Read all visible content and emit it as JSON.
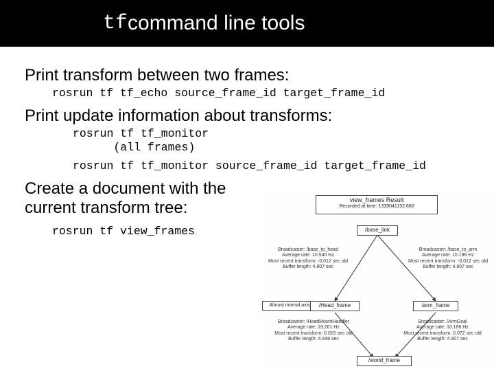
{
  "title": {
    "mono": "tf",
    "rest": " command line tools"
  },
  "sections": {
    "s1": {
      "head": "Print transform between two frames:",
      "cmd": "rosrun tf tf_echo source_frame_id target_frame_id"
    },
    "s2": {
      "head": "Print update information about transforms:",
      "cmd1": "rosrun tf tf_monitor\n      (all frames)",
      "cmd2": "rosrun tf tf_monitor source_frame_id target_frame_id"
    },
    "s3": {
      "head": "Create a document with the current transform tree:",
      "cmd": "rosrun tf view_frames"
    }
  },
  "diagram": {
    "topTitle": "view_frames Result",
    "topSub": "Recorded at time: 1339041152.680",
    "root": "/base_link",
    "leftEdge": "Broadcaster: /base_to_head\nAverage rate: 10.540 Hz\nMost recent transform: -0.012 sec old\nBuffer length: 4.807 sec",
    "rightEdge": "Broadcaster: /base_to_arm\nAverage rate: 10.196 Hz\nMost recent transform: -0.012 sec old\nBuffer length: 4.807 sec",
    "midLeftLabel": "Almost normal axis frame",
    "midLeft": "/Head_frame",
    "midLeftEdge": "Broadcaster: /HeadMountHandler\nAverage rate: 19.201 Hz\nMost recent transform: 0.015 sec old\nBuffer length: 4.848 sec",
    "midRight": "/arm_frame",
    "midRightEdge": "Broadcaster: /ArmGoal\nAverage rate: 10.186 Hz\nMost recent transform: 0.072 sec old\nBuffer length: 4.907 sec",
    "bottom": "/world_frame"
  }
}
